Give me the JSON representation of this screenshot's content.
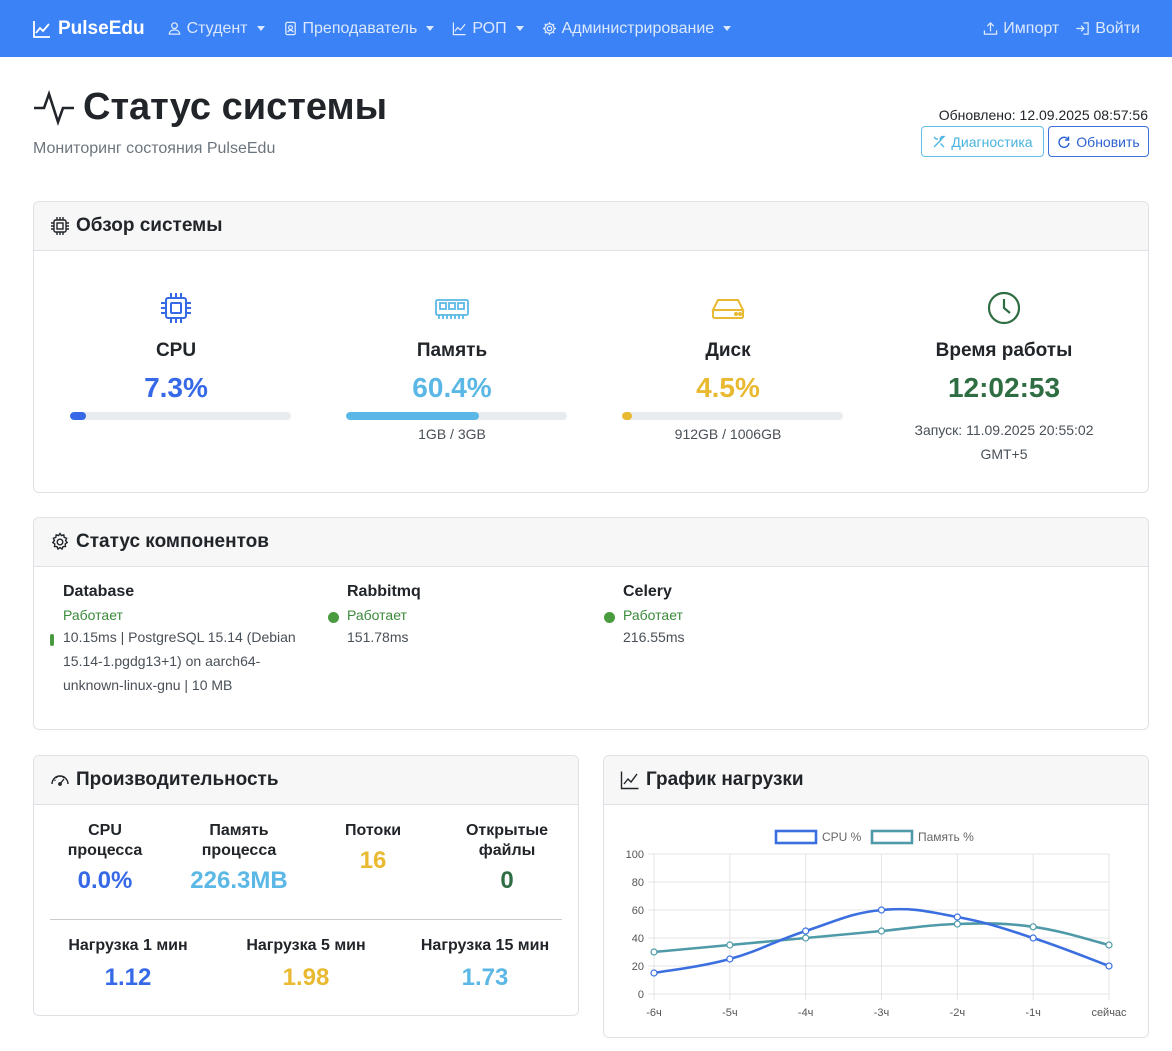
{
  "nav": {
    "brand": "PulseEdu",
    "items": [
      {
        "label": "Студент",
        "icon": "user-icon"
      },
      {
        "label": "Преподаватель",
        "icon": "badge-icon"
      },
      {
        "label": "РОП",
        "icon": "chart-line-icon"
      },
      {
        "label": "Администрирование",
        "icon": "gear-icon"
      }
    ],
    "import_label": "Импорт",
    "login_label": "Войти"
  },
  "header": {
    "title": "Статус системы",
    "subtitle": "Мониторинг состояния PulseEdu",
    "updated": "Обновлено: 12.09.2025 08:57:56",
    "diagnostics_label": "Диагностика",
    "refresh_label": "Обновить"
  },
  "overview": {
    "title": "Обзор системы",
    "cpu": {
      "label": "CPU",
      "value": "7.3%",
      "percent": 7.3,
      "color": "#3569e8"
    },
    "memory": {
      "label": "Память",
      "value": "60.4%",
      "percent": 60.4,
      "sub": "1GB / 3GB",
      "color": "#5bb8e6"
    },
    "disk": {
      "label": "Диск",
      "value": "4.5%",
      "percent": 4.5,
      "sub": "912GB / 1006GB",
      "color": "#e9b932"
    },
    "uptime": {
      "label": "Время работы",
      "value": "12:02:53",
      "sub": "Запуск: 11.09.2025 20:55:02",
      "sub2": "GMT+5",
      "color": "#2e6e42"
    }
  },
  "components": {
    "title": "Статус компонентов",
    "items": [
      {
        "name": "Database",
        "status": "Работает",
        "detail_lines": [
          "10.15ms | PostgreSQL 15.14 (Debian",
          "15.14-1.pgdg13+1) on aarch64-",
          "unknown-linux-gnu | 10 MB"
        ]
      },
      {
        "name": "Rabbitmq",
        "status": "Работает",
        "detail_lines": [
          "151.78ms"
        ]
      },
      {
        "name": "Celery",
        "status": "Работает",
        "detail_lines": [
          "216.55ms"
        ]
      }
    ]
  },
  "performance": {
    "title": "Производительность",
    "cpu_process": {
      "label_lines": [
        "CPU",
        "процесса"
      ],
      "value": "0.0%",
      "color": "#3569e8"
    },
    "mem_process": {
      "label_lines": [
        "Память",
        "процесса"
      ],
      "value": "226.3MB",
      "color": "#5bb8e6"
    },
    "threads": {
      "label": "Потоки",
      "value": "16",
      "color": "#e9b932"
    },
    "open_files": {
      "label_lines": [
        "Открытые",
        "файлы"
      ],
      "value": "0",
      "color": "#2e6e42"
    },
    "load1": {
      "label": "Нагрузка 1 мин",
      "value": "1.12",
      "color": "#3569e8"
    },
    "load5": {
      "label": "Нагрузка 5 мин",
      "value": "1.98",
      "color": "#e9b932"
    },
    "load15": {
      "label": "Нагрузка 15 мин",
      "value": "1.73",
      "color": "#5bb8e6"
    }
  },
  "load_chart": {
    "title": "График нагрузки"
  },
  "chart_data": {
    "type": "line",
    "categories": [
      "-6ч",
      "-5ч",
      "-4ч",
      "-3ч",
      "-2ч",
      "-1ч",
      "сейчас"
    ],
    "series": [
      {
        "name": "CPU %",
        "values": [
          15,
          25,
          45,
          60,
          55,
          40,
          20
        ],
        "color": "#3b6fe0"
      },
      {
        "name": "Память %",
        "values": [
          30,
          35,
          40,
          45,
          50,
          48,
          35
        ],
        "color": "#4f9aa8"
      }
    ],
    "ylim": [
      0,
      100
    ],
    "yticks": [
      0,
      20,
      40,
      60,
      80,
      100
    ],
    "legend": "top",
    "grid": true
  }
}
